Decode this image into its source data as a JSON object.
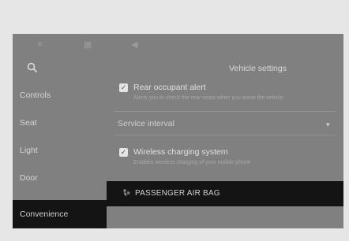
{
  "topbar": {
    "icons": [
      "close-icon",
      "grid-icon",
      "volume-icon"
    ]
  },
  "sidebar": {
    "search_icon": "search-icon",
    "items": [
      {
        "label": "Controls"
      },
      {
        "label": "Seat"
      },
      {
        "label": "Light"
      },
      {
        "label": "Door"
      },
      {
        "label": "Convenience",
        "active": true
      }
    ]
  },
  "main": {
    "title": "Vehicle settings",
    "options": [
      {
        "label": "Rear occupant alert",
        "desc": "Alerts you to check the rear seats when you leave the vehicle",
        "checked": true
      },
      {
        "label": "Wireless charging system",
        "desc": "Enables wireless charging of your mobile phone",
        "checked": true
      }
    ],
    "section": {
      "label": "Service interval"
    },
    "airbag_bar": {
      "label": "PASSENGER AIR BAG",
      "icon": "airbag-icon"
    }
  }
}
